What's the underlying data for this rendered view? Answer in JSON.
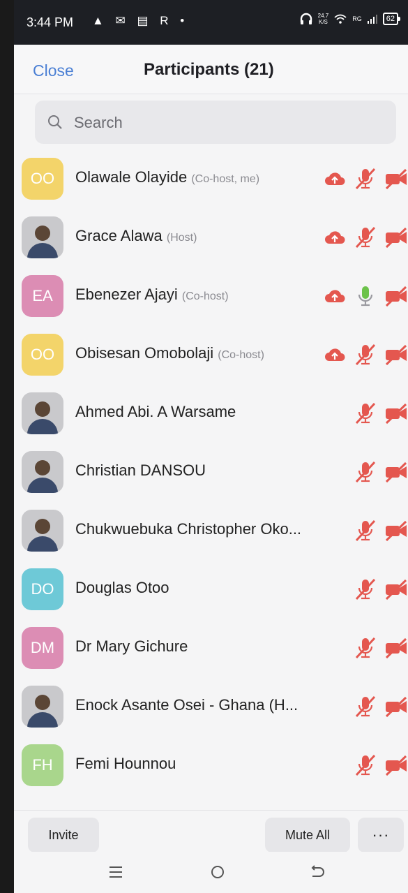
{
  "status_bar": {
    "time": "3:44 PM",
    "left_icons": "▲ ✉ ▤ R •",
    "speed_top": "24.7",
    "speed_bottom": "K/S",
    "network": "RG",
    "battery": "62"
  },
  "header": {
    "close_label": "Close",
    "title": "Participants (21)"
  },
  "search": {
    "placeholder": "Search"
  },
  "participants": [
    {
      "name": "Olawale Olayide",
      "role": "(Co-host, me)",
      "initials": "OO",
      "avatar_color": "#f3d46a",
      "cloud": true,
      "mic": "muted",
      "video": "off"
    },
    {
      "name": "Grace Alawa",
      "role": "(Host)",
      "initials": "",
      "avatar_color": "#c9c9cc",
      "cloud": true,
      "mic": "muted",
      "video": "off"
    },
    {
      "name": "Ebenezer Ajayi",
      "role": "(Co-host)",
      "initials": "EA",
      "avatar_color": "#dc8db4",
      "cloud": true,
      "mic": "on",
      "video": "off"
    },
    {
      "name": "Obisesan Omobolaji",
      "role": "(Co-host)",
      "initials": "OO",
      "avatar_color": "#f3d46a",
      "cloud": true,
      "mic": "muted",
      "video": "off"
    },
    {
      "name": "Ahmed Abi. A Warsame",
      "role": "",
      "initials": "",
      "avatar_color": "#c9c9cc",
      "cloud": false,
      "mic": "muted",
      "video": "off"
    },
    {
      "name": "Christian DANSOU",
      "role": "",
      "initials": "",
      "avatar_color": "#c9c9cc",
      "cloud": false,
      "mic": "muted",
      "video": "off"
    },
    {
      "name": "Chukwuebuka Christopher Oko...",
      "role": "",
      "initials": "",
      "avatar_color": "#c9c9cc",
      "cloud": false,
      "mic": "muted",
      "video": "off"
    },
    {
      "name": "Douglas Otoo",
      "role": "",
      "initials": "DO",
      "avatar_color": "#6ec9d7",
      "cloud": false,
      "mic": "muted",
      "video": "off"
    },
    {
      "name": "Dr Mary Gichure",
      "role": "",
      "initials": "DM",
      "avatar_color": "#dc8db4",
      "cloud": false,
      "mic": "muted",
      "video": "off"
    },
    {
      "name": "Enock Asante Osei - Ghana (H...",
      "role": "",
      "initials": "",
      "avatar_color": "#c9c9cc",
      "cloud": false,
      "mic": "muted",
      "video": "off"
    },
    {
      "name": "Femi Hounnou",
      "role": "",
      "initials": "FH",
      "avatar_color": "#a9d68c",
      "cloud": false,
      "mic": "muted",
      "video": "off"
    }
  ],
  "footer": {
    "invite_label": "Invite",
    "mute_all_label": "Mute All",
    "more_label": "···"
  },
  "colors": {
    "accent": "#4a7fd4",
    "muted_red": "#e4574f",
    "mic_on_green": "#6cc24a"
  }
}
